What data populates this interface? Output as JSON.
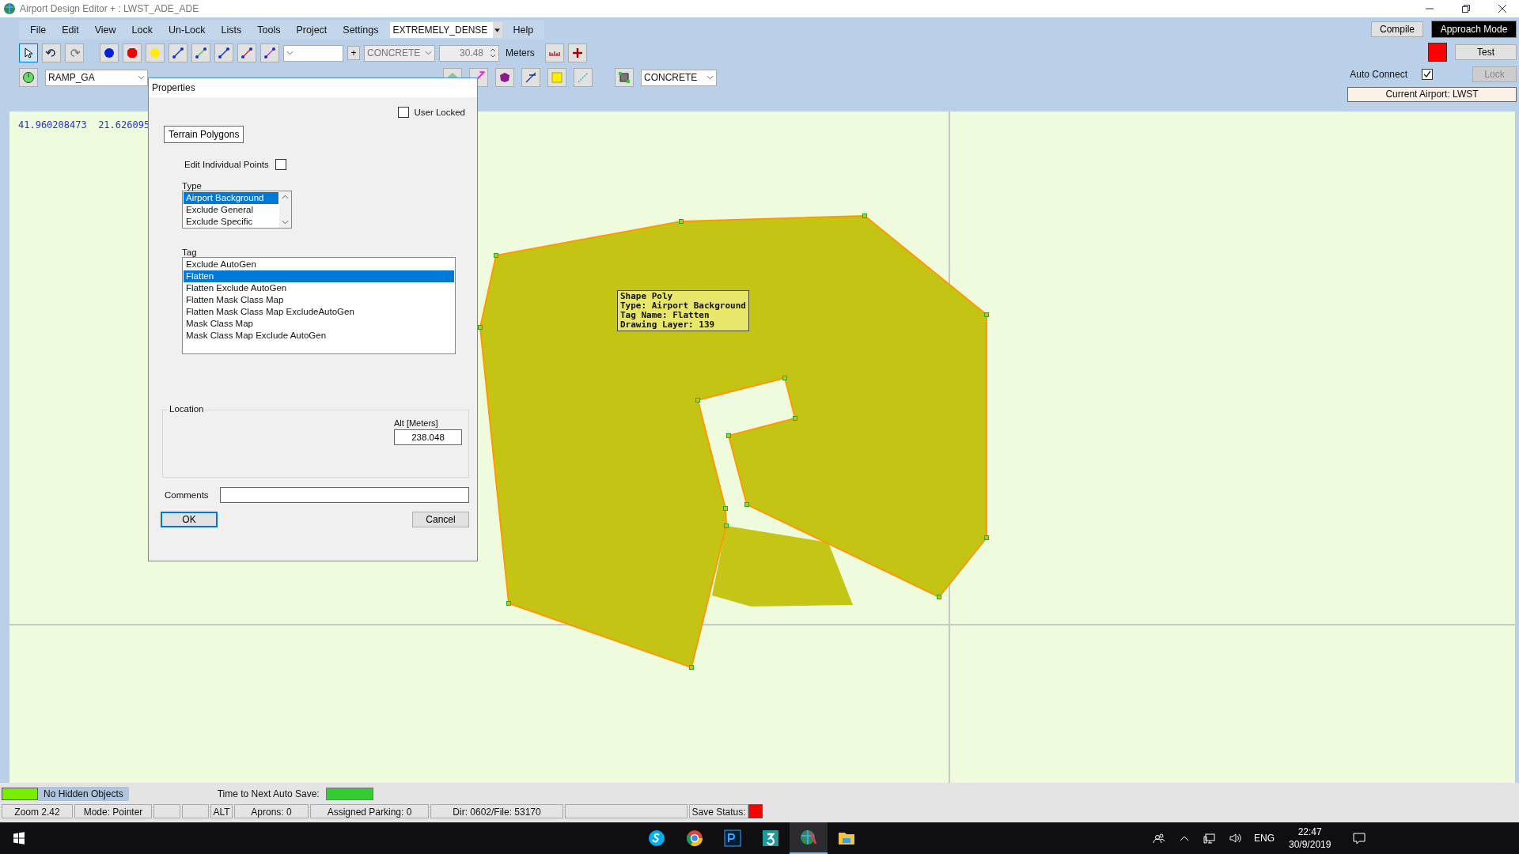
{
  "window": {
    "title": "Airport Design Editor + : LWST_ADE_ADE"
  },
  "menu": {
    "items": [
      "File",
      "Edit",
      "View",
      "Lock",
      "Un-Lock",
      "Lists",
      "Tools",
      "Project",
      "Settings"
    ],
    "density_select": "EXTREMELY_DENSE",
    "trailing": [
      "Help"
    ]
  },
  "toolbar": {
    "add_button": "+",
    "surface_select": "CONCRETE",
    "width_value": "30.48",
    "unit": "Meters",
    "ramp_select": "RAMP_GA",
    "surface_select_2": "CONCRETE"
  },
  "right_panel": {
    "compile": "Compile",
    "approach_mode": "Approach Mode",
    "test": "Test",
    "auto_connect": {
      "label": "Auto Connect",
      "checked": true
    },
    "lock": {
      "label": "Lock",
      "disabled": true
    },
    "current_airport": "Current Airport: LWST"
  },
  "map": {
    "coordinates": "41.960208473  21.626095",
    "tooltip": [
      "Shape Poly",
      "Type: Airport Background",
      "Tag Name: Flatten",
      "Drawing Layer: 139"
    ]
  },
  "dialog": {
    "title": "Properties",
    "user_locked": {
      "label": "User Locked",
      "checked": false
    },
    "category_button": "Terrain Polygons",
    "edit_points": {
      "label": "Edit Individual Points",
      "checked": false
    },
    "type_label": "Type",
    "types": [
      {
        "label": "Airport Background",
        "selected": true
      },
      {
        "label": "Exclude General",
        "selected": false
      },
      {
        "label": "Exclude Specific",
        "selected": false
      }
    ],
    "tag_label": "Tag",
    "tags": [
      {
        "label": "Exclude AutoGen",
        "selected": false
      },
      {
        "label": "Flatten",
        "selected": true
      },
      {
        "label": "Flatten Exclude AutoGen",
        "selected": false
      },
      {
        "label": "Flatten Mask Class Map",
        "selected": false
      },
      {
        "label": "Flatten Mask Class Map ExcludeAutoGen",
        "selected": false
      },
      {
        "label": "Mask Class Map",
        "selected": false
      },
      {
        "label": "Mask Class Map Exclude AutoGen",
        "selected": false
      }
    ],
    "location_label": "Location",
    "alt_label": "Alt [Meters]",
    "alt_value": "238.048",
    "comments_label": "Comments",
    "ok": "OK",
    "cancel": "Cancel"
  },
  "status": {
    "hidden_objects": "No Hidden Objects",
    "autosave_label": "Time to Next Auto Save:",
    "cells": [
      {
        "kind": "text",
        "text": "Zoom 2.42"
      },
      {
        "kind": "text",
        "text": "Mode: Pointer"
      },
      {
        "kind": "blank"
      },
      {
        "kind": "blank"
      },
      {
        "kind": "text",
        "text": "ALT"
      },
      {
        "kind": "text",
        "text": "Aprons: 0"
      },
      {
        "kind": "text",
        "text": "Assigned Parking: 0"
      },
      {
        "kind": "text",
        "text": "Dir: 0602/File: 53170"
      },
      {
        "kind": "blank"
      }
    ],
    "save_status": "Save Status:"
  },
  "taskbar": {
    "time": "22:47",
    "date": "30/9/2019",
    "language": "ENG"
  }
}
